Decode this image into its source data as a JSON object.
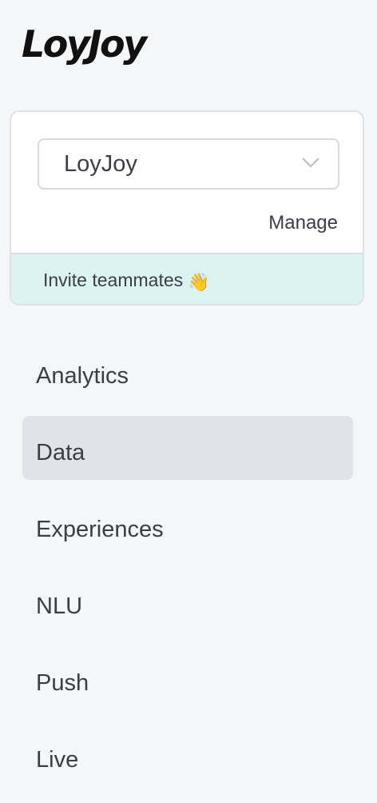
{
  "brand": {
    "logo_text": "LoyJoy"
  },
  "workspace": {
    "selected": "LoyJoy",
    "manage_label": "Manage",
    "invite_label": "Invite teammates",
    "invite_emoji": "👋",
    "dropdown_icon": "chevron-down-icon"
  },
  "nav": {
    "active": "Data",
    "items": [
      {
        "label": "Analytics"
      },
      {
        "label": "Data"
      },
      {
        "label": "Experiences"
      },
      {
        "label": "NLU"
      },
      {
        "label": "Push"
      },
      {
        "label": "Live"
      }
    ]
  },
  "colors": {
    "background": "#f5f6f8",
    "card": "#ffffff",
    "invite_bar": "#dbf4f1",
    "active_item": "#e2e3e8",
    "text": "#3b3e45"
  }
}
